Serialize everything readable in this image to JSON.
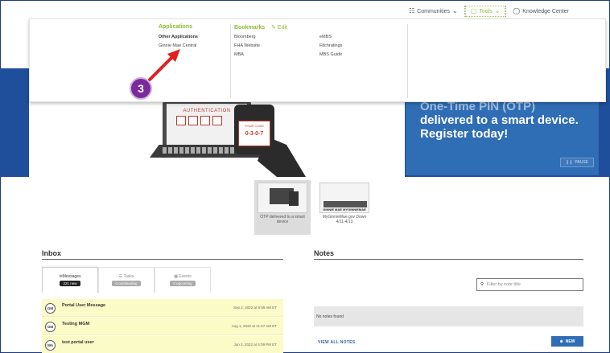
{
  "topnav": {
    "communities": "Communities",
    "tools": "Tools",
    "knowledge_center": "Knowledge Center"
  },
  "dropdown": {
    "applications_heading": "Applications",
    "applications": [
      "Other Applications",
      "Ginnie Mae Central"
    ],
    "bookmarks_heading": "Bookmarks",
    "edit_label": "Edit",
    "bookmarks_col1": [
      "Bloomberg",
      "FHA Website",
      "MBA"
    ],
    "bookmarks_col2": [
      "eMBS",
      "Fitchratings",
      "MBS Guide"
    ]
  },
  "annotation": {
    "step": "3"
  },
  "hero": {
    "auth_label": "AUTHENTICATION",
    "your_code_label": "YOUR CODE",
    "code_value": "0-3-0-7",
    "promo_line1": "One-Time PIN (OTP)",
    "promo_line2": "delivered to a smart device. Register today!",
    "pause_label": "PAUSE"
  },
  "carousel": [
    {
      "caption": "OTP delivered to a smart device"
    },
    {
      "image_text": "GINNIE MAE MYGINNIEMAE",
      "caption": "MyGinnieMae.gov Down 4/11-4/13"
    }
  ],
  "inbox": {
    "title": "Inbox",
    "tabs": [
      {
        "label": "Messages",
        "badge": "221 new"
      },
      {
        "label": "Tasks",
        "badge": "0 outstanding"
      },
      {
        "label": "Events",
        "badge": "0 upcoming"
      }
    ],
    "messages": [
      {
        "avatar": "GM",
        "subject": "Portal User Message",
        "date": "Sep 2, 2022 at 9:56 AM ET"
      },
      {
        "avatar": "GM",
        "subject": "Testing MGM",
        "date": "Aug 1, 2022 at 11:57 AM ET"
      },
      {
        "avatar": "WA",
        "subject": "test portal user",
        "date": "Jun 2, 2022 at 4:09 PM ET"
      }
    ]
  },
  "notes": {
    "title": "Notes",
    "filter_placeholder": "Filter by note title",
    "empty_text": "No notes found",
    "view_all": "VIEW ALL NOTES",
    "new_label": "NEW"
  }
}
